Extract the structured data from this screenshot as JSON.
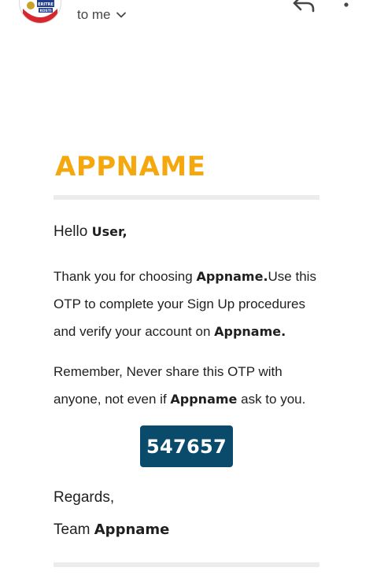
{
  "header": {
    "recipient_text": "to me",
    "reply_icon": "reply-icon",
    "more_icon": "more-vert-icon",
    "chevron_icon": "chevron-down-icon",
    "avatar_badge": "ERITRE KOSTI"
  },
  "email": {
    "brand": "APPNAME",
    "greeting_prefix": "Hello ",
    "greeting_name": "User,",
    "p1_a": "Thank you for choosing ",
    "p1_app": "Appname.",
    "p1_b": "Use this OTP to complete your Sign Up procedures and verify your account on ",
    "p1_app2": "Appname.",
    "p2_a": "Remember, Never share this OTP with anyone, not even if ",
    "p2_app": "Appname",
    "p2_b": " ask to you.",
    "otp": "547657",
    "regards": "Regards,",
    "team_prefix": "Team ",
    "team_name": "Appname"
  },
  "colors": {
    "brand": "#f5a70e",
    "otp_bg": "#0a4a6b",
    "divider": "#ececec"
  }
}
